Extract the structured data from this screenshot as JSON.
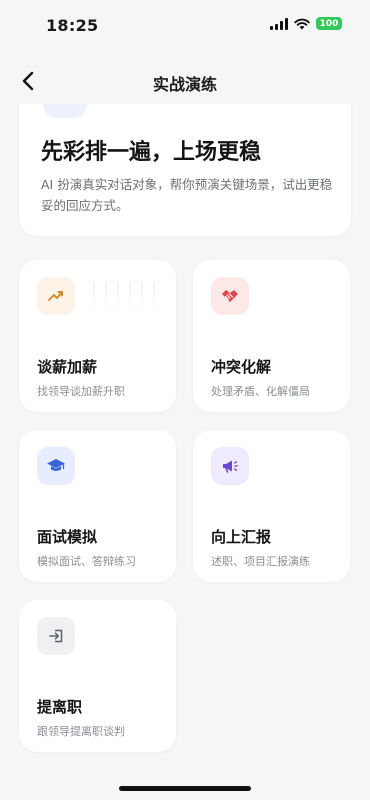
{
  "status_bar": {
    "time": "18:25",
    "battery": "100",
    "battery_color": "#34c759",
    "icons": [
      "cellular-signal-icon",
      "wifi-icon",
      "battery-icon"
    ]
  },
  "nav": {
    "title": "实战演练",
    "back_icon": "chevron-left-icon"
  },
  "hero": {
    "title": "先彩排一遍，上场更稳",
    "description": "AI 扮演真实对话对象，帮你预演关键场景，试出更稳妥的回应方式。"
  },
  "cards": [
    {
      "title": "谈薪加薪",
      "description": "找领导谈加薪升职",
      "icon": "trending-up-icon",
      "icon_bg": "#fdf3e6",
      "icon_color": "#d38a2c"
    },
    {
      "title": "冲突化解",
      "description": "处理矛盾、化解僵局",
      "icon": "handshake-icon",
      "icon_bg": "#fde8e8",
      "icon_color": "#e0444b"
    },
    {
      "title": "面试模拟",
      "description": "模拟面试、答辩练习",
      "icon": "graduation-cap-icon",
      "icon_bg": "#e7edfd",
      "icon_color": "#3a64d8"
    },
    {
      "title": "向上汇报",
      "description": "述职、项目汇报演练",
      "icon": "megaphone-icon",
      "icon_bg": "#efeafd",
      "icon_color": "#6a47d6"
    },
    {
      "title": "提离职",
      "description": "跟领导提离职谈判",
      "icon": "exit-icon",
      "icon_bg": "#eff0f2",
      "icon_color": "#5c6068"
    }
  ]
}
